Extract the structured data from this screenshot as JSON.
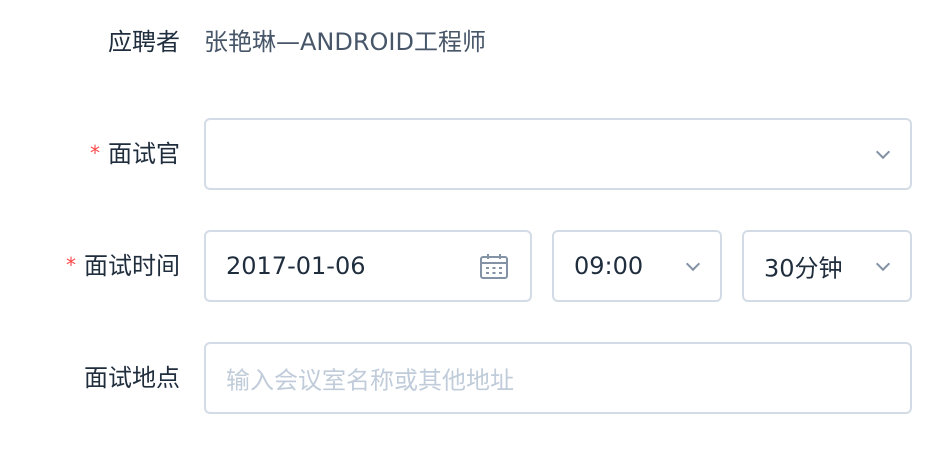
{
  "applicant": {
    "label": "应聘者",
    "value": "张艳琳—ANDROID工程师"
  },
  "interviewer": {
    "required_mark": "*",
    "label": "面试官",
    "value": ""
  },
  "interview_time": {
    "required_mark": "*",
    "label": "面试时间",
    "date": "2017-01-06",
    "time": "09:00",
    "duration": "30分钟"
  },
  "location": {
    "label": "面试地点",
    "placeholder": "输入会议室名称或其他地址",
    "value": ""
  }
}
